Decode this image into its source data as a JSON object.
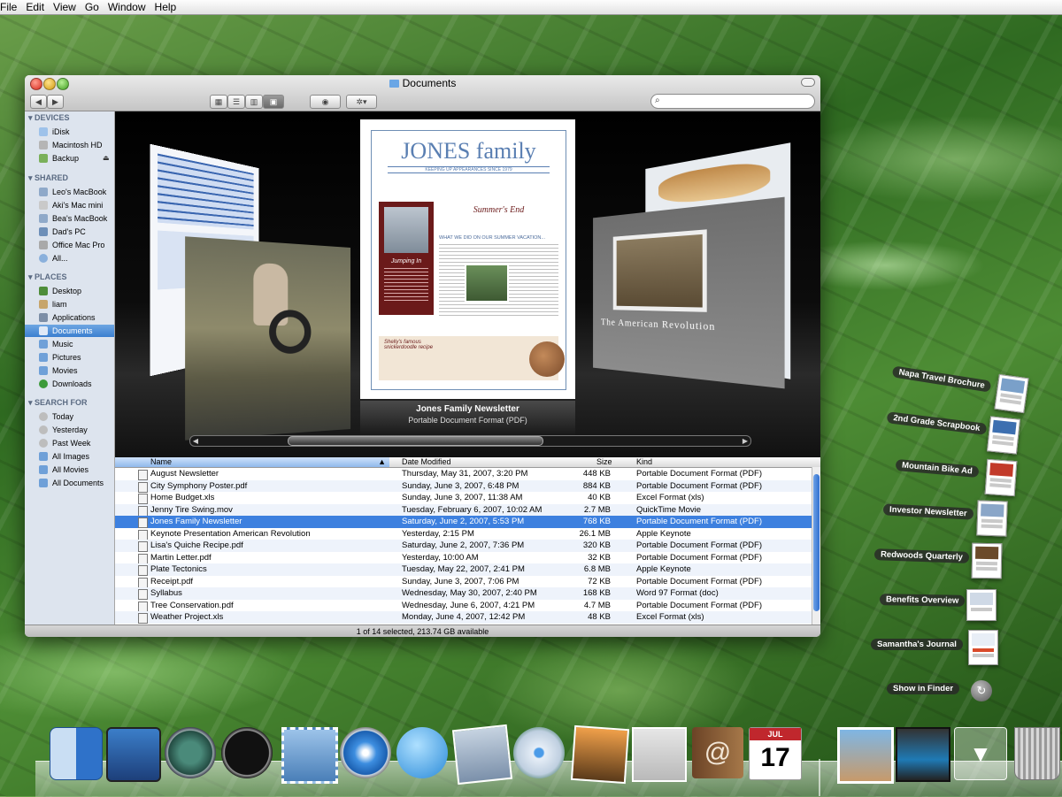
{
  "menubar": {
    "items": [
      "File",
      "Edit",
      "View",
      "Go",
      "Window",
      "Help"
    ]
  },
  "window": {
    "title": "Documents",
    "search_placeholder": "",
    "sidebar": {
      "devices_header": "DEVICES",
      "devices": [
        "iDisk",
        "Macintosh HD",
        "Backup"
      ],
      "shared_header": "SHARED",
      "shared": [
        "Leo's MacBook",
        "Aki's Mac mini",
        "Bea's MacBook",
        "Dad's PC",
        "Office Mac Pro",
        "All..."
      ],
      "places_header": "PLACES",
      "places": [
        "Desktop",
        "liam",
        "Applications",
        "Documents",
        "Music",
        "Pictures",
        "Movies",
        "Downloads"
      ],
      "search_header": "SEARCH FOR",
      "search": [
        "Today",
        "Yesterday",
        "Past Week",
        "All Images",
        "All Movies",
        "All Documents"
      ]
    },
    "coverflow": {
      "selected_title": "Jones Family Newsletter",
      "selected_kind": "Portable Document Format (PDF)",
      "newsletter_masthead": "JONES family",
      "newsletter_tagline": "KEEPING UP APPEARANCES SINCE 1979",
      "newsletter_heading": "Summer's End",
      "newsletter_subhead": "WHAT WE DID ON OUR SUMMER VACATION...",
      "newsletter_sidebar": "Jumping In",
      "newsletter_recipe": "Shelly's famous snickerdoodle recipe",
      "right_doc_title": "The American Revolution"
    },
    "list": {
      "columns": [
        "Name",
        "Date Modified",
        "Size",
        "Kind"
      ],
      "rows": [
        {
          "name": "August Newsletter",
          "date": "Thursday, May 31, 2007, 3:20 PM",
          "size": "448 KB",
          "kind": "Portable Document Format (PDF)"
        },
        {
          "name": "City Symphony Poster.pdf",
          "date": "Sunday, June 3, 2007, 6:48 PM",
          "size": "884 KB",
          "kind": "Portable Document Format (PDF)"
        },
        {
          "name": "Home Budget.xls",
          "date": "Sunday, June 3, 2007, 11:38 AM",
          "size": "40 KB",
          "kind": "Excel Format (xls)"
        },
        {
          "name": "Jenny Tire Swing.mov",
          "date": "Tuesday, February 6, 2007, 10:02 AM",
          "size": "2.7 MB",
          "kind": "QuickTime Movie"
        },
        {
          "name": "Jones Family Newsletter",
          "date": "Saturday, June 2, 2007, 5:53 PM",
          "size": "768 KB",
          "kind": "Portable Document Format (PDF)"
        },
        {
          "name": "Keynote Presentation American Revolution",
          "date": "Yesterday, 2:15 PM",
          "size": "26.1 MB",
          "kind": "Apple Keynote"
        },
        {
          "name": "Lisa's Quiche Recipe.pdf",
          "date": "Saturday, June 2, 2007, 7:36 PM",
          "size": "320 KB",
          "kind": "Portable Document Format (PDF)"
        },
        {
          "name": "Martin Letter.pdf",
          "date": "Yesterday, 10:00 AM",
          "size": "32 KB",
          "kind": "Portable Document Format (PDF)"
        },
        {
          "name": "Plate Tectonics",
          "date": "Tuesday, May 22, 2007, 2:41 PM",
          "size": "6.8 MB",
          "kind": "Apple Keynote"
        },
        {
          "name": "Receipt.pdf",
          "date": "Sunday, June 3, 2007, 7:06 PM",
          "size": "72 KB",
          "kind": "Portable Document Format (PDF)"
        },
        {
          "name": "Syllabus",
          "date": "Wednesday, May 30, 2007, 2:40 PM",
          "size": "168 KB",
          "kind": "Word 97 Format (doc)"
        },
        {
          "name": "Tree Conservation.pdf",
          "date": "Wednesday, June 6, 2007, 4:21 PM",
          "size": "4.7 MB",
          "kind": "Portable Document Format (PDF)"
        },
        {
          "name": "Weather Project.xls",
          "date": "Monday, June 4, 2007, 12:42 PM",
          "size": "48 KB",
          "kind": "Excel Format (xls)"
        }
      ],
      "selected_index": 4
    },
    "status": "1 of 14 selected, 213.74 GB available"
  },
  "stack": {
    "items": [
      "Napa Travel Brochure",
      "2nd Grade Scrapbook",
      "Mountain Bike Ad",
      "Investor Newsletter",
      "Redwoods Quarterly",
      "Benefits Overview",
      "Samantha's Journal"
    ],
    "show_in_finder": "Show in Finder"
  },
  "dock": {
    "calendar_month": "JUL",
    "calendar_day": "17",
    "icons": [
      "finder-icon",
      "dashboard-icon",
      "time-machine-icon",
      "front-row-icon",
      "mail-icon",
      "safari-icon",
      "ichat-icon",
      "iphoto-stamp-icon",
      "itunes-icon",
      "iphoto-icon",
      "preview-icon",
      "address-book-icon",
      "ical-icon",
      "pictures-stack-icon",
      "movies-stack-icon",
      "documents-stack-icon",
      "trash-icon"
    ]
  },
  "colors": {
    "selection": "#3d80df",
    "sidebar_bg": "#dde4ee",
    "accent": "#3b7fd0"
  }
}
